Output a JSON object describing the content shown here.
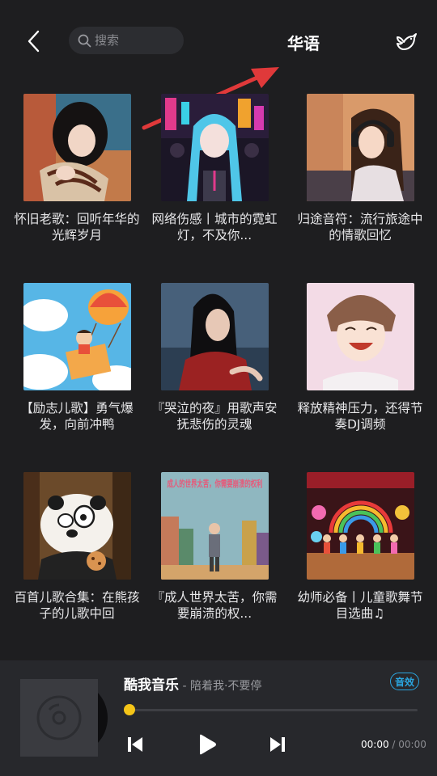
{
  "header": {
    "back_icon": "chevron-left-icon",
    "search_icon": "search-icon",
    "search_placeholder": "搜索",
    "title": "华语",
    "share_icon": "bird-share-icon"
  },
  "playlists": [
    {
      "title": "怀旧老歌：回听年华的光辉岁月"
    },
    {
      "title": "网络伤感丨城市的霓虹灯，不及你..."
    },
    {
      "title": "归途音符：流行旅途中的情歌回忆"
    },
    {
      "title": "【励志儿歌】勇气爆发，向前冲鸭"
    },
    {
      "title": "『哭泣的夜』用歌声安抚悲伤的灵魂"
    },
    {
      "title": "释放精神压力，还得节奏DJ调频"
    },
    {
      "title": "百首儿歌合集：在熊孩子的儿歌中回"
    },
    {
      "title": "『成人世界太苦，你需要崩溃的权..."
    },
    {
      "title": "幼师必备丨儿童歌舞节目选曲♫"
    }
  ],
  "cover_text": {
    "poster": "成人的世界太苦，你需要崩溃的权利"
  },
  "player": {
    "title": "酷我音乐",
    "subtitle": " - 陪着我·不要停",
    "effect_label": "音效",
    "current_time": "00:00",
    "separator": " / ",
    "total_time": "00:00",
    "progress": 0
  },
  "colors": {
    "background": "#1e1e20",
    "player_bg": "#27282c",
    "accent_yellow": "#f5c518",
    "accent_blue": "#2aa6e0",
    "arrow_red": "#e0393a"
  }
}
